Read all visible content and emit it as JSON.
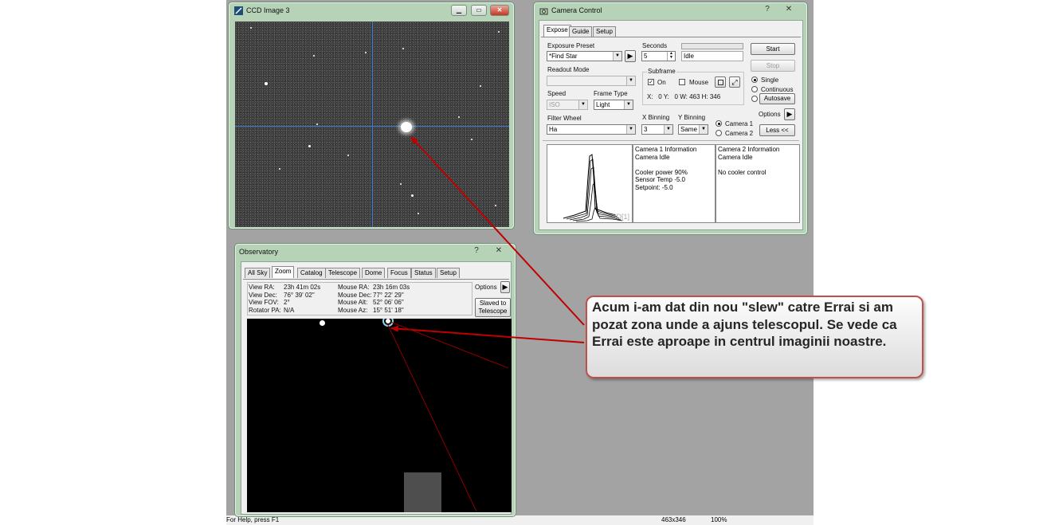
{
  "status_bar": {
    "help": "For Help, press F1",
    "image_size": "463x346",
    "zoom": "100%"
  },
  "ccd_window": {
    "title": "CCD Image 3"
  },
  "camera_control": {
    "title": "Camera Control",
    "tabs": [
      "Expose",
      "Guide",
      "Setup"
    ],
    "exposure_preset_label": "Exposure Preset",
    "exposure_preset_value": "*Find Star",
    "seconds_label": "Seconds",
    "seconds_value": "5",
    "status_value": "Idle",
    "readout_mode_label": "Readout Mode",
    "subframe_label": "Subframe",
    "subframe_on_label": "On",
    "subframe_mouse_label": "Mouse",
    "subframe_coords": "X:   0 Y:   0 W: 463 H: 346",
    "speed_label": "Speed",
    "speed_value": "ISO",
    "frame_type_label": "Frame Type",
    "frame_type_value": "Light",
    "filter_wheel_label": "Filter Wheel",
    "filter_wheel_value": "Ha",
    "x_binning_label": "X Binning",
    "x_binning_value": "3",
    "y_binning_label": "Y Binning",
    "y_binning_value": "Same",
    "camera1_label": "Camera 1",
    "camera2_label": "Camera 2",
    "start_label": "Start",
    "stop_label": "Stop",
    "mode_single": "Single",
    "mode_continuous": "Continuous",
    "mode_autosave": "Autosave",
    "options_label": "Options",
    "less_label": "Less <<",
    "graph_label": "3D[1]",
    "camera1_info": "Camera 1 Information\nCamera Idle\n\nCooler power 90%\nSensor Temp -5.0\nSetpoint: -5.0",
    "camera2_info": "Camera 2 Information\nCamera Idle\n\nNo cooler control"
  },
  "observatory": {
    "title": "Observatory",
    "tabs": [
      "All Sky",
      "Zoom",
      "Catalog",
      "Telescope",
      "Dome",
      "Focus",
      "Status",
      "Setup"
    ],
    "view_ra_label": "View RA:",
    "view_ra": "23h 41m 02s",
    "view_dec_label": "View Dec:",
    "view_dec": "76° 39' 02\"",
    "view_fov_label": "View FOV:",
    "view_fov": "2°",
    "rotator_pa_label": "Rotator PA:",
    "rotator_pa": "N/A",
    "mouse_ra_label": "Mouse RA:",
    "mouse_ra": "23h 16m 03s",
    "mouse_dec_label": "Mouse Dec:",
    "mouse_dec": "77° 22' 29\"",
    "mouse_alt_label": "Mouse Alt:",
    "mouse_alt": "52° 06' 06\"",
    "mouse_az_label": "Mouse Az:",
    "mouse_az": "15° 51' 18\"",
    "options_label": "Options",
    "slaved_label_1": "Slaved to",
    "slaved_label_2": "Telescope"
  },
  "callout": {
    "text": "Acum i-am dat din nou \"slew\" catre Errai si am pozat zona unde a ajuns telescopul. Se vede ca Errai este aproape in centrul imaginii noastre.",
    "border_color": "#c0504d"
  },
  "colors": {
    "arrow": "#c00000",
    "crosshair": "#3b7fd6",
    "window_frame": "#b7d3b7"
  }
}
